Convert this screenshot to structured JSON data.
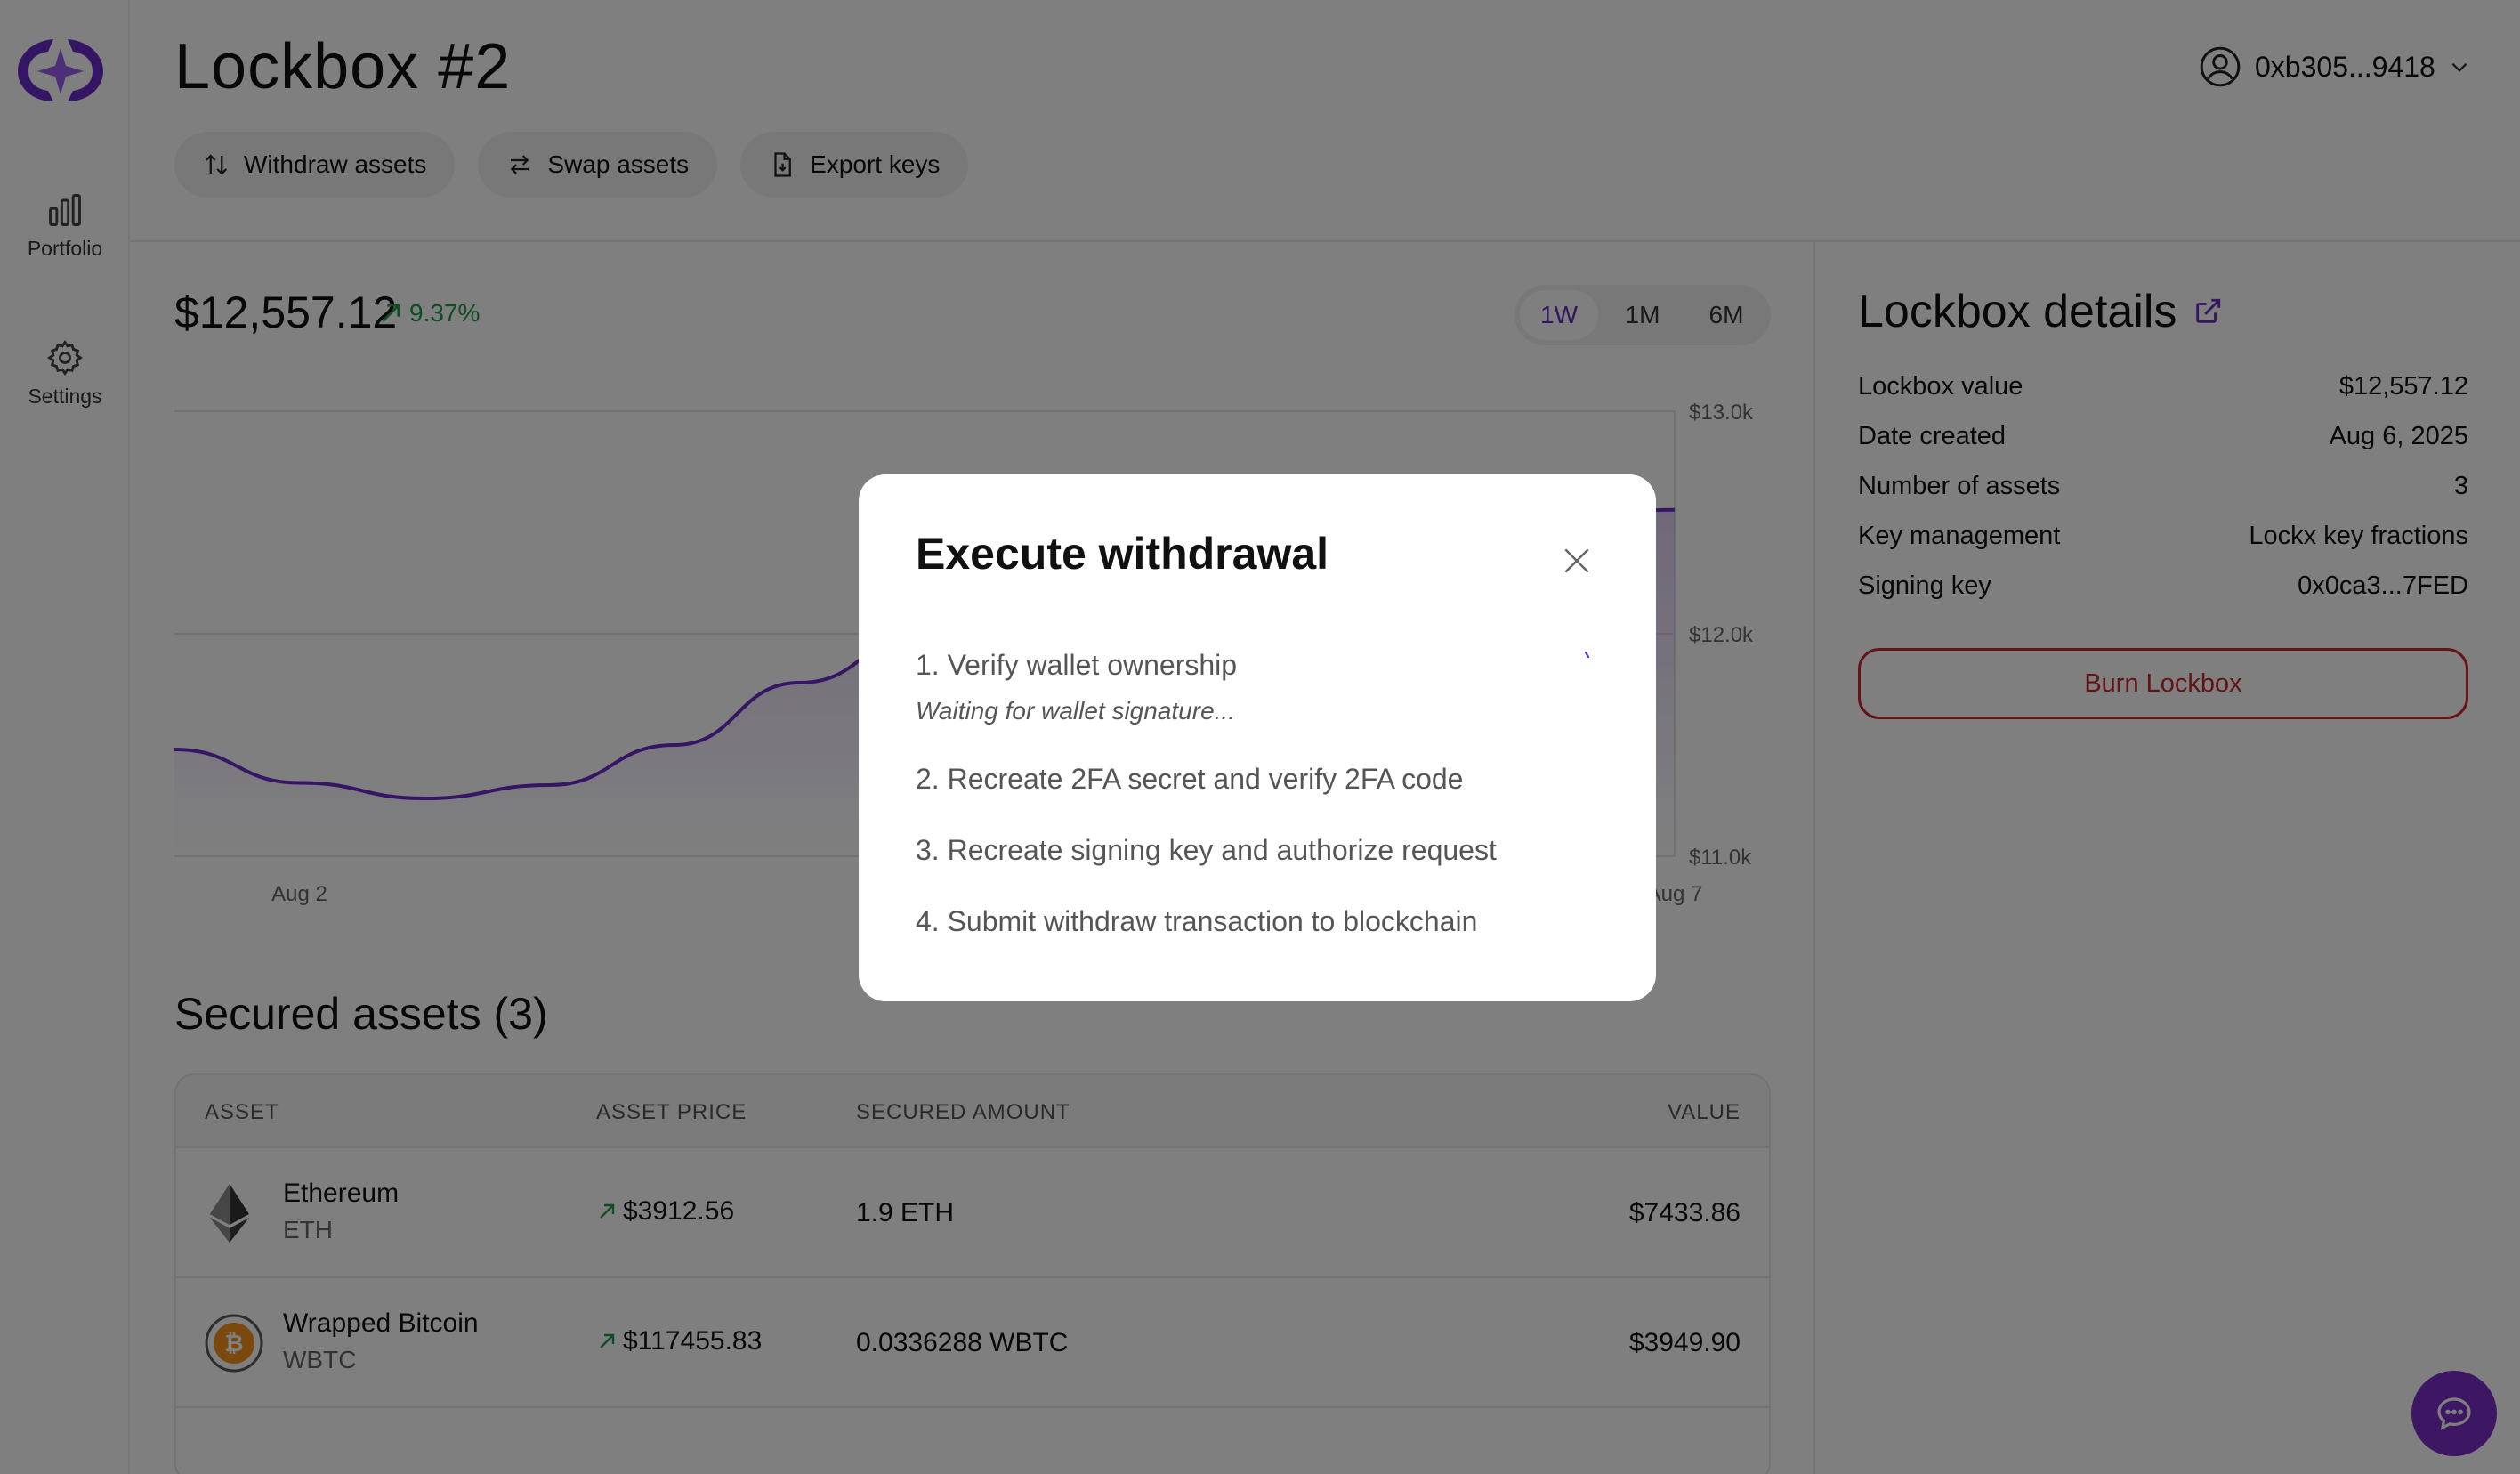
{
  "sidebar": {
    "items": [
      {
        "label": "Portfolio",
        "icon": "bar-chart-icon"
      },
      {
        "label": "Settings",
        "icon": "gear-icon"
      }
    ]
  },
  "header": {
    "title": "Lockbox #2",
    "account": "0xb305...9418",
    "actions": [
      {
        "label": "Withdraw assets",
        "icon": "swap-vertical-icon"
      },
      {
        "label": "Swap assets",
        "icon": "swap-horizontal-icon"
      },
      {
        "label": "Export keys",
        "icon": "file-export-icon"
      }
    ]
  },
  "portfolio": {
    "balance": "$12,557.12",
    "change": "9.37%",
    "ranges": [
      "1W",
      "1M",
      "6M"
    ],
    "selected_range": "1W"
  },
  "chart_data": {
    "type": "area",
    "x_ticks": [
      "Aug 2",
      "Aug 7"
    ],
    "y_ticks": [
      "$13.0k",
      "$12.0k",
      "$11.0k"
    ],
    "ylim": [
      11000,
      13000
    ],
    "x": [
      0,
      0.5,
      1,
      1.5,
      2,
      2.5,
      3,
      3.5,
      4,
      4.5,
      5,
      5.5,
      6
    ],
    "values": [
      11480,
      11330,
      11260,
      11320,
      11500,
      11780,
      12000,
      12120,
      12180,
      12250,
      12380,
      12520,
      12557
    ],
    "grid": true,
    "line_color": "#6a2cc9"
  },
  "assets": {
    "title": "Secured assets (3)",
    "columns": [
      "ASSET",
      "ASSET PRICE",
      "SECURED AMOUNT",
      "VALUE"
    ],
    "rows": [
      {
        "name": "Ethereum",
        "symbol": "ETH",
        "price": "$3912.56",
        "amount": "1.9 ETH",
        "value": "$7433.86",
        "icon": "ethereum-icon"
      },
      {
        "name": "Wrapped Bitcoin",
        "symbol": "WBTC",
        "price": "$117455.83",
        "amount": "0.0336288 WBTC",
        "value": "$3949.90",
        "icon": "bitcoin-icon"
      }
    ]
  },
  "details": {
    "title": "Lockbox details",
    "rows": [
      {
        "label": "Lockbox value",
        "value": "$12,557.12"
      },
      {
        "label": "Date created",
        "value": "Aug 6, 2025"
      },
      {
        "label": "Number of assets",
        "value": "3"
      },
      {
        "label": "Key management",
        "value": "Lockx key fractions"
      },
      {
        "label": "Signing key",
        "value": "0x0ca3...7FED"
      }
    ],
    "burn_label": "Burn Lockbox"
  },
  "modal": {
    "title": "Execute withdrawal",
    "steps": [
      "1. Verify wallet ownership",
      "2. Recreate 2FA secret and verify 2FA code",
      "3. Recreate signing key and authorize request",
      "4. Submit withdraw transaction to blockchain"
    ],
    "status": "Waiting for wallet signature..."
  },
  "colors": {
    "accent": "#6a2cc9",
    "positive": "#1e9a4a",
    "danger": "#c62a2a"
  }
}
